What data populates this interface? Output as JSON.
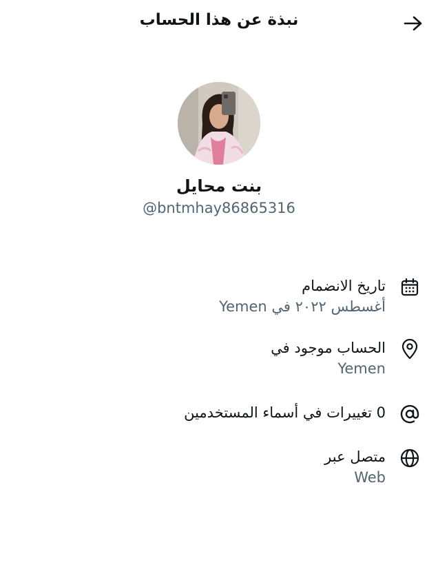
{
  "header": {
    "title": "نبذة عن هذا الحساب",
    "back_icon": "arrow-right-icon"
  },
  "profile": {
    "display_name": "بنت محايل",
    "handle": "@bntmhay86865316",
    "avatar_icon": "profile-photo"
  },
  "details": {
    "joined": {
      "icon": "calendar-icon",
      "label": "تاريخ الانضمام",
      "value": "أغسطس ٢٠٢٢ في Yemen"
    },
    "location": {
      "icon": "location-pin-icon",
      "label": "الحساب موجود في",
      "value": "Yemen"
    },
    "username_changes": {
      "icon": "at-sign-icon",
      "label": "0 تغييرات في أسماء المستخدمين"
    },
    "connected_via": {
      "icon": "globe-icon",
      "label": "متصل عبر",
      "value": "Web"
    }
  },
  "colors": {
    "text": "#0f1419",
    "secondary": "#536471",
    "background": "#ffffff"
  }
}
